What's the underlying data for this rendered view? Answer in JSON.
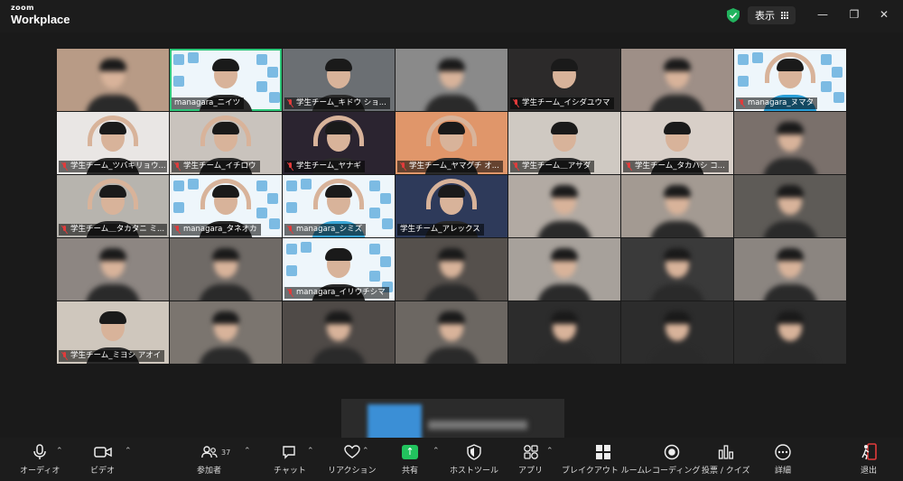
{
  "window": {
    "brand_top": "zoom",
    "brand_bottom": "Workplace",
    "view_label": "表示"
  },
  "participants": [
    {
      "name": "",
      "blurred": true,
      "bg": "#b89b86"
    },
    {
      "name": "managara_ニイツ",
      "muted": false,
      "banner": true,
      "active": true
    },
    {
      "name": "学生チーム_キドウ ショ...",
      "muted": true,
      "bg": "#6b6f73"
    },
    {
      "name": "",
      "blurred": true,
      "bg": "#8a8a8a"
    },
    {
      "name": "学生チーム_イシダユウマ",
      "muted": true,
      "bg": "#2c2a2a"
    },
    {
      "name": "",
      "blurred": true,
      "bg": "#9e8f87"
    },
    {
      "name": "managara_ヌマタ",
      "muted": true,
      "banner": true,
      "arms": true,
      "shirt": "#2a9fd8"
    },
    {
      "name": "学生チーム_ツバキリョウ...",
      "muted": true,
      "bg": "#e9e6e4",
      "arms": true
    },
    {
      "name": "学生チーム_イチロウ",
      "muted": true,
      "bg": "#c9c3bd",
      "arms": true
    },
    {
      "name": "学生チーム_ヤナギ",
      "muted": true,
      "bg": "#2b2430",
      "arms": true
    },
    {
      "name": "学生チーム_ヤマグチ オ...",
      "muted": true,
      "bg": "#e0966a",
      "arms": true
    },
    {
      "name": "学生チーム＿アサダ",
      "muted": true,
      "bg": "#cfc9c2"
    },
    {
      "name": "学生チーム_タカハシ コ...",
      "muted": true,
      "bg": "#d8cfc8"
    },
    {
      "name": "",
      "blurred": true,
      "bg": "#7a706b"
    },
    {
      "name": "学生チーム＿タカタニ ミ...",
      "muted": true,
      "bg": "#b7b4ae",
      "arms": true
    },
    {
      "name": "managara_タネオカ",
      "muted": true,
      "banner": true,
      "arms": true
    },
    {
      "name": "managara_シミズ",
      "muted": true,
      "banner": true,
      "arms": true,
      "shirt": "#3aa6d6"
    },
    {
      "name": "学生チーム_アレックス",
      "muted": false,
      "bg": "#2e3a5a",
      "arms": true
    },
    {
      "name": "",
      "blurred": true,
      "bg": "#b2aaa3"
    },
    {
      "name": "",
      "blurred": true,
      "bg": "#a39a92"
    },
    {
      "name": "",
      "blurred": true,
      "bg": "#5e5b57"
    },
    {
      "name": "",
      "blurred": true,
      "bg": "#8d8682"
    },
    {
      "name": "",
      "blurred": true,
      "bg": "#6f6a66"
    },
    {
      "name": "managara_イリウチシマ",
      "muted": true,
      "banner": true
    },
    {
      "name": "",
      "blurred": true,
      "bg": "#55504c"
    },
    {
      "name": "",
      "blurred": true,
      "bg": "#a7a19b"
    },
    {
      "name": "",
      "blurred": true,
      "bg": "#3a3a3a"
    },
    {
      "name": "",
      "blurred": true,
      "bg": "#8b8580"
    },
    {
      "name": "学生チーム_ミヨシ アオイ",
      "muted": true,
      "bg": "#cfc7bd"
    },
    {
      "name": "",
      "blurred": true,
      "bg": "#7b756f"
    },
    {
      "name": "",
      "blurred": true,
      "bg": "#4f4a47"
    },
    {
      "name": "",
      "blurred": true,
      "bg": "#6c6762"
    },
    {
      "name": "",
      "blurred": true,
      "bg": "#2c2c2c"
    },
    {
      "name": "",
      "blurred": true,
      "bg": "#2c2c2c"
    },
    {
      "name": "",
      "blurred": true,
      "bg": "#2c2c2c"
    }
  ],
  "toolbar": {
    "audio": "オーディオ",
    "video": "ビデオ",
    "participants": "参加者",
    "participants_count": "37",
    "chat": "チャット",
    "reactions": "リアクション",
    "share": "共有",
    "host_tools": "ホストツール",
    "apps": "アプリ",
    "breakout": "ブレイクアウト ルーム",
    "record": "レコーディング",
    "polls": "投票 / クイズ",
    "more": "詳細",
    "leave": "退出"
  },
  "colors": {
    "active_speaker": "#2ec77a",
    "share": "#22c35e",
    "muted": "#e23b3b"
  }
}
